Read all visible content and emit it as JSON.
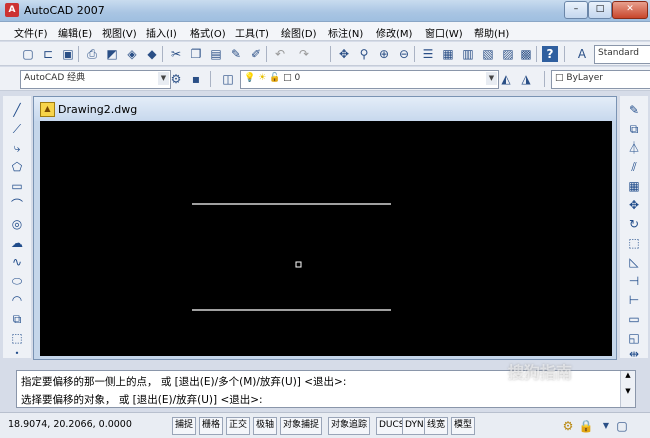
{
  "app": {
    "title": "AutoCAD 2007",
    "icon_letter": "A"
  },
  "window_controls": {
    "minimize": "–",
    "maximize": "□",
    "close": "✕"
  },
  "menu": [
    "文件(F)",
    "编辑(E)",
    "视图(V)",
    "插入(I)",
    "格式(O)",
    "工具(T)",
    "绘图(D)",
    "标注(N)",
    "修改(M)",
    "窗口(W)",
    "帮助(H)"
  ],
  "toolbar": {
    "text_style": "Standard",
    "workspace": "AutoCAD 经典",
    "layer_name": "0",
    "linetype": "ByLayer"
  },
  "document": {
    "tab_title": "Drawing2.dwg"
  },
  "command": {
    "line1": "指定要偏移的那一侧上的点， 或 [退出(E)/多个(M)/放弃(U)] <退出>:",
    "line2": "选择要偏移的对象， 或 [退出(E)/放弃(U)] <退出>:"
  },
  "status": {
    "coordinates": "18.9074, 20.2066, 0.0000",
    "buttons": [
      "捕捉",
      "栅格",
      "正交",
      "极轴",
      "对象捕捉",
      "对象追踪",
      "DUCS",
      "DYN",
      "线宽",
      "模型"
    ]
  },
  "watermark": {
    "text": "搜狗指南",
    "url": "zhinan.sogou.com"
  },
  "colors": {
    "canvas": "#000000",
    "line": "#ffffff",
    "titlebar": "#a9c5e3"
  }
}
